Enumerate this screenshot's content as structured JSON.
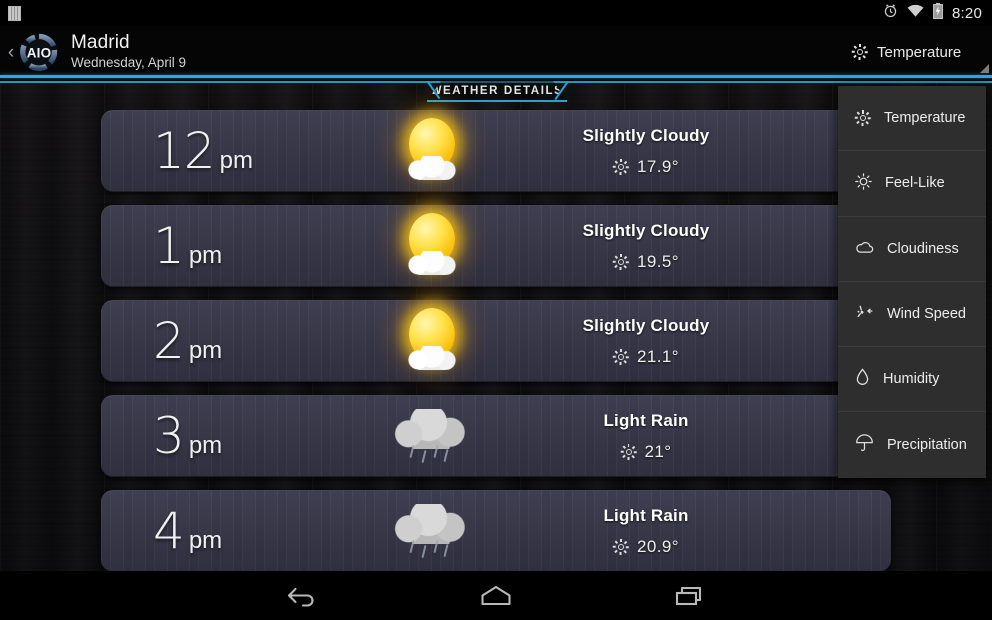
{
  "statusbar": {
    "notification_icon": "notification-bars-icon",
    "alarm_icon": "alarm-clock-icon",
    "wifi_icon": "wifi-icon",
    "battery_icon": "battery-charging-icon",
    "time": "8:20"
  },
  "actionbar": {
    "back_chevron": "‹",
    "logo_text": "AIO",
    "city": "Madrid",
    "date": "Wednesday, April 9",
    "spinner_label": "Temperature",
    "spinner_icon": "sun-icon"
  },
  "content": {
    "tab_label": "WEATHER DETAILS",
    "accent_color": "#2b9fd4"
  },
  "forecast": {
    "rows": [
      {
        "hour": "12",
        "ampm": "pm",
        "condition": "Slightly Cloudy",
        "value": "17.9°",
        "art": "sun-behind-cloud-icon"
      },
      {
        "hour": "1",
        "ampm": "pm",
        "condition": "Slightly Cloudy",
        "value": "19.5°",
        "art": "sun-behind-cloud-icon"
      },
      {
        "hour": "2",
        "ampm": "pm",
        "condition": "Slightly Cloudy",
        "value": "21.1°",
        "art": "sun-behind-cloud-icon"
      },
      {
        "hour": "3",
        "ampm": "pm",
        "condition": "Light Rain",
        "value": "21°",
        "art": "rain-cloud-icon"
      },
      {
        "hour": "4",
        "ampm": "pm",
        "condition": "Light Rain",
        "value": "20.9°",
        "art": "rain-cloud-icon"
      }
    ]
  },
  "menu": {
    "items": [
      {
        "label": "Temperature",
        "icon": "sun-icon"
      },
      {
        "label": "Feel-Like",
        "icon": "sun-outline-icon"
      },
      {
        "label": "Cloudiness",
        "icon": "cloud-icon"
      },
      {
        "label": "Wind Speed",
        "icon": "wind-icon"
      },
      {
        "label": "Humidity",
        "icon": "droplet-icon"
      },
      {
        "label": "Precipitation",
        "icon": "umbrella-icon"
      }
    ]
  },
  "navbar": {
    "back_label": "back-icon",
    "home_label": "home-icon",
    "recents_label": "recents-icon"
  }
}
